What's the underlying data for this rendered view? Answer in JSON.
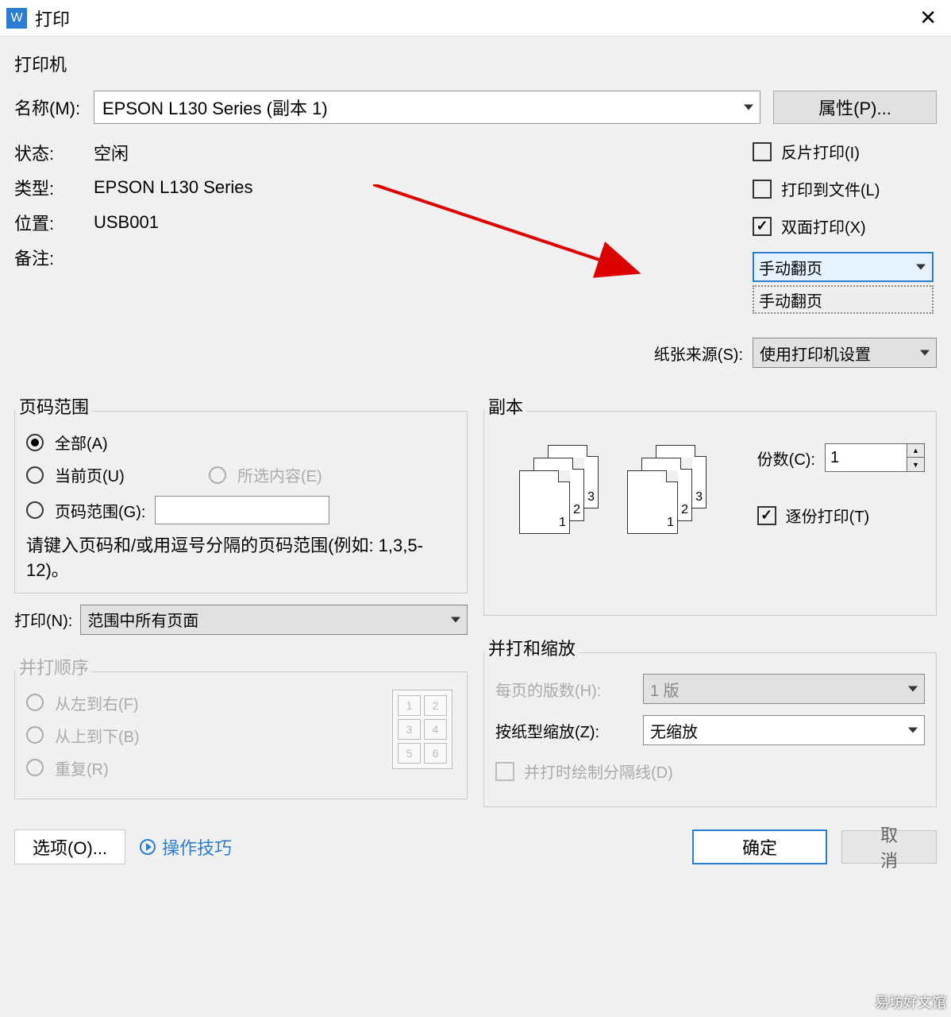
{
  "titlebar": {
    "title": "打印"
  },
  "printer_section": {
    "header": "打印机",
    "name_label": "名称(M):",
    "name_value": "EPSON L130 Series (副本 1)",
    "properties_btn": "属性(P)...",
    "status_label": "状态:",
    "status_value": "空闲",
    "type_label": "类型:",
    "type_value": "EPSON L130 Series",
    "location_label": "位置:",
    "location_value": "USB001",
    "note_label": "备注:",
    "cb_mirror": "反片打印(I)",
    "cb_tofile": "打印到文件(L)",
    "cb_duplex": "双面打印(X)",
    "duplex_mode": "手动翻页",
    "duplex_option": "手动翻页",
    "source_label": "纸张来源(S):",
    "source_value": "使用打印机设置"
  },
  "range_section": {
    "header": "页码范围",
    "all": "全部(A)",
    "current": "当前页(U)",
    "selection": "所选内容(E)",
    "pages": "页码范围(G):",
    "hint": "请键入页码和/或用逗号分隔的页码范围(例如: 1,3,5-12)。",
    "print_what_label": "打印(N):",
    "print_what_value": "范围中所有页面"
  },
  "order_section": {
    "header": "并打顺序",
    "ltr": "从左到右(F)",
    "ttb": "从上到下(B)",
    "repeat": "重复(R)"
  },
  "copies_section": {
    "header": "副本",
    "copies_label": "份数(C):",
    "copies_value": "1",
    "collate": "逐份打印(T)"
  },
  "zoom_section": {
    "header": "并打和缩放",
    "pps_label": "每页的版数(H):",
    "pps_value": "1 版",
    "scale_label": "按纸型缩放(Z):",
    "scale_value": "无缩放",
    "divider": "并打时绘制分隔线(D)"
  },
  "bottom": {
    "options": "选项(O)...",
    "tips": "操作技巧",
    "ok": "确定",
    "cancel": "取消"
  },
  "watermark": "易坊好文馆"
}
